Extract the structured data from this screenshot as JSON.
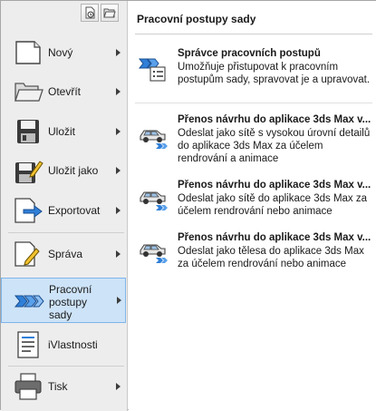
{
  "menu": {
    "items": [
      {
        "label": "Nový",
        "icon": "new-document-icon"
      },
      {
        "label": "Otevřít",
        "icon": "open-folder-icon"
      },
      {
        "label": "Uložit",
        "icon": "save-disk-icon"
      },
      {
        "label": "Uložit jako",
        "icon": "save-as-icon"
      },
      {
        "label": "Exportovat",
        "icon": "export-icon"
      },
      {
        "label": "Správa",
        "icon": "manage-icon"
      },
      {
        "label": "Pracovní postupy sady",
        "lines": [
          "Pracovní",
          "postupy",
          "sady"
        ],
        "icon": "suite-workflows-icon"
      },
      {
        "label": "iVlastnosti",
        "icon": "iproperties-icon"
      },
      {
        "label": "Tisk",
        "icon": "print-icon"
      }
    ]
  },
  "quick_access": [
    "open-recent-icon",
    "open-folder-icon"
  ],
  "panel": {
    "title": "Pracovní postupy sady",
    "entries": [
      {
        "title": "Správce pracovních postupů",
        "description": "Umožňuje přistupovat k pracovním postupům sady, spravovat je a upravovat.",
        "icon": "workflow-manager-icon"
      },
      {
        "title": "Přenos návrhu do aplikace 3ds Max v...",
        "description": "Odeslat jako sítě s vysokou úrovní detailů do aplikace 3ds Max za účelem rendrování a animace",
        "icon": "car-send-icon"
      },
      {
        "title": "Přenos návrhu do aplikace 3ds Max v...",
        "description": "Odeslat jako sítě do aplikace 3ds Max za účelem rendrování nebo animace",
        "icon": "car-send-icon"
      },
      {
        "title": "Přenos návrhu do aplikace 3ds Max v...",
        "description": "Odeslat jako tělesa do aplikace 3ds Max za účelem rendrování nebo animace",
        "icon": "car-send-icon"
      }
    ]
  },
  "colors": {
    "active_bg": "#cde3f7",
    "active_border": "#7eb4ea",
    "accent_blue": "#1f6fd1"
  }
}
